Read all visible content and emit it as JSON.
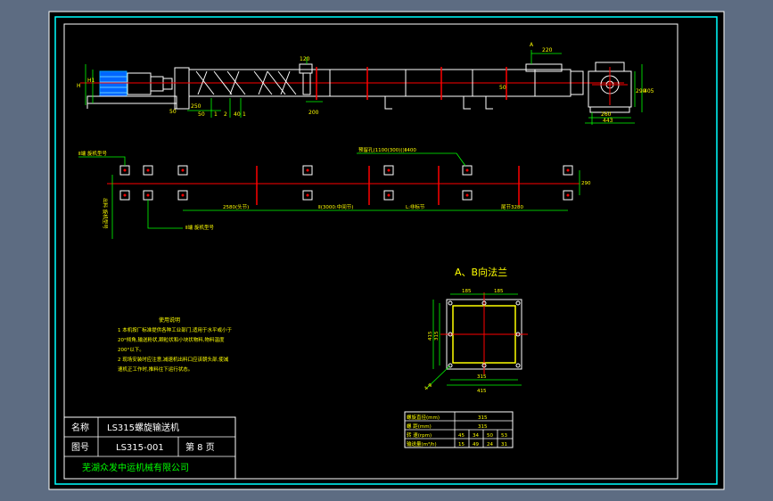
{
  "colors": {
    "background": "#5d6c82",
    "paper": "#000000",
    "frame": "#00ffff",
    "line": "#ffffff",
    "center": "#ff0000",
    "dim": "#00ff00",
    "text": "#ffff00",
    "motor": "#00a0ff",
    "titleText": "#ffffff",
    "company": "#00ff00"
  },
  "top_view": {
    "dims": {
      "h": "H",
      "h1": "H1",
      "d50": "50",
      "d250": "250",
      "d50b": "50",
      "d1": "1",
      "d2": "2",
      "d40": "40",
      "d1b": "1",
      "d120": "120",
      "d200": "200",
      "d220": "220",
      "dA": "A",
      "d405": "405",
      "d290": "290",
      "d50c": "50",
      "d260": "260",
      "d443": "443"
    }
  },
  "layout_plan": {
    "label_tl": "Ⅱ端 旋机型号",
    "label_lv": "出料 旋机型号",
    "label_bottom": "Ⅱ端 旋机型号",
    "label_hole": "预留孔(1100(300)()Ⅱ400",
    "seg1": "2580(头节)",
    "seg2": "Ⅱ(3000:中间节)",
    "seg3": "L:非标节",
    "seg4": "尾节3280",
    "dim_right": "290"
  },
  "flange": {
    "title": "A、B向法兰",
    "top1": "185",
    "top2": "185",
    "left1": "415",
    "left2": "315",
    "bottom1": "315",
    "bottom2": "415",
    "hole": "4-φ"
  },
  "notes": {
    "heading": "使用说明",
    "lines": [
      "1  本机按厂标准提供各种工业部门,适用于水平或小于",
      "20°倾角,输送粉状,颗粒状和小块状物料,物料温度",
      "200°以下。",
      "2  现场安装时应注意,减速机出料口应该朝头部,使减",
      "速机正工作时,推料往下运行状态。"
    ]
  },
  "spec_table": {
    "rows": [
      {
        "label": "螺旋直径(mm)",
        "values": [
          "315"
        ]
      },
      {
        "label": "螺    距(mm)",
        "values": [
          "315"
        ]
      },
      {
        "label": "转    速(rpm)",
        "values": [
          "45",
          "34",
          "50",
          "53"
        ]
      },
      {
        "label": "输送量(m³/h)",
        "values": [
          "15",
          "49",
          "24",
          "31"
        ]
      }
    ]
  },
  "title_block": {
    "name_label": "名称",
    "name_value": "LS315螺旋输送机",
    "code_label": "图号",
    "code_value": "LS315-001",
    "page": "第 8 页",
    "company": "芜湖众发中运机械有限公司"
  }
}
